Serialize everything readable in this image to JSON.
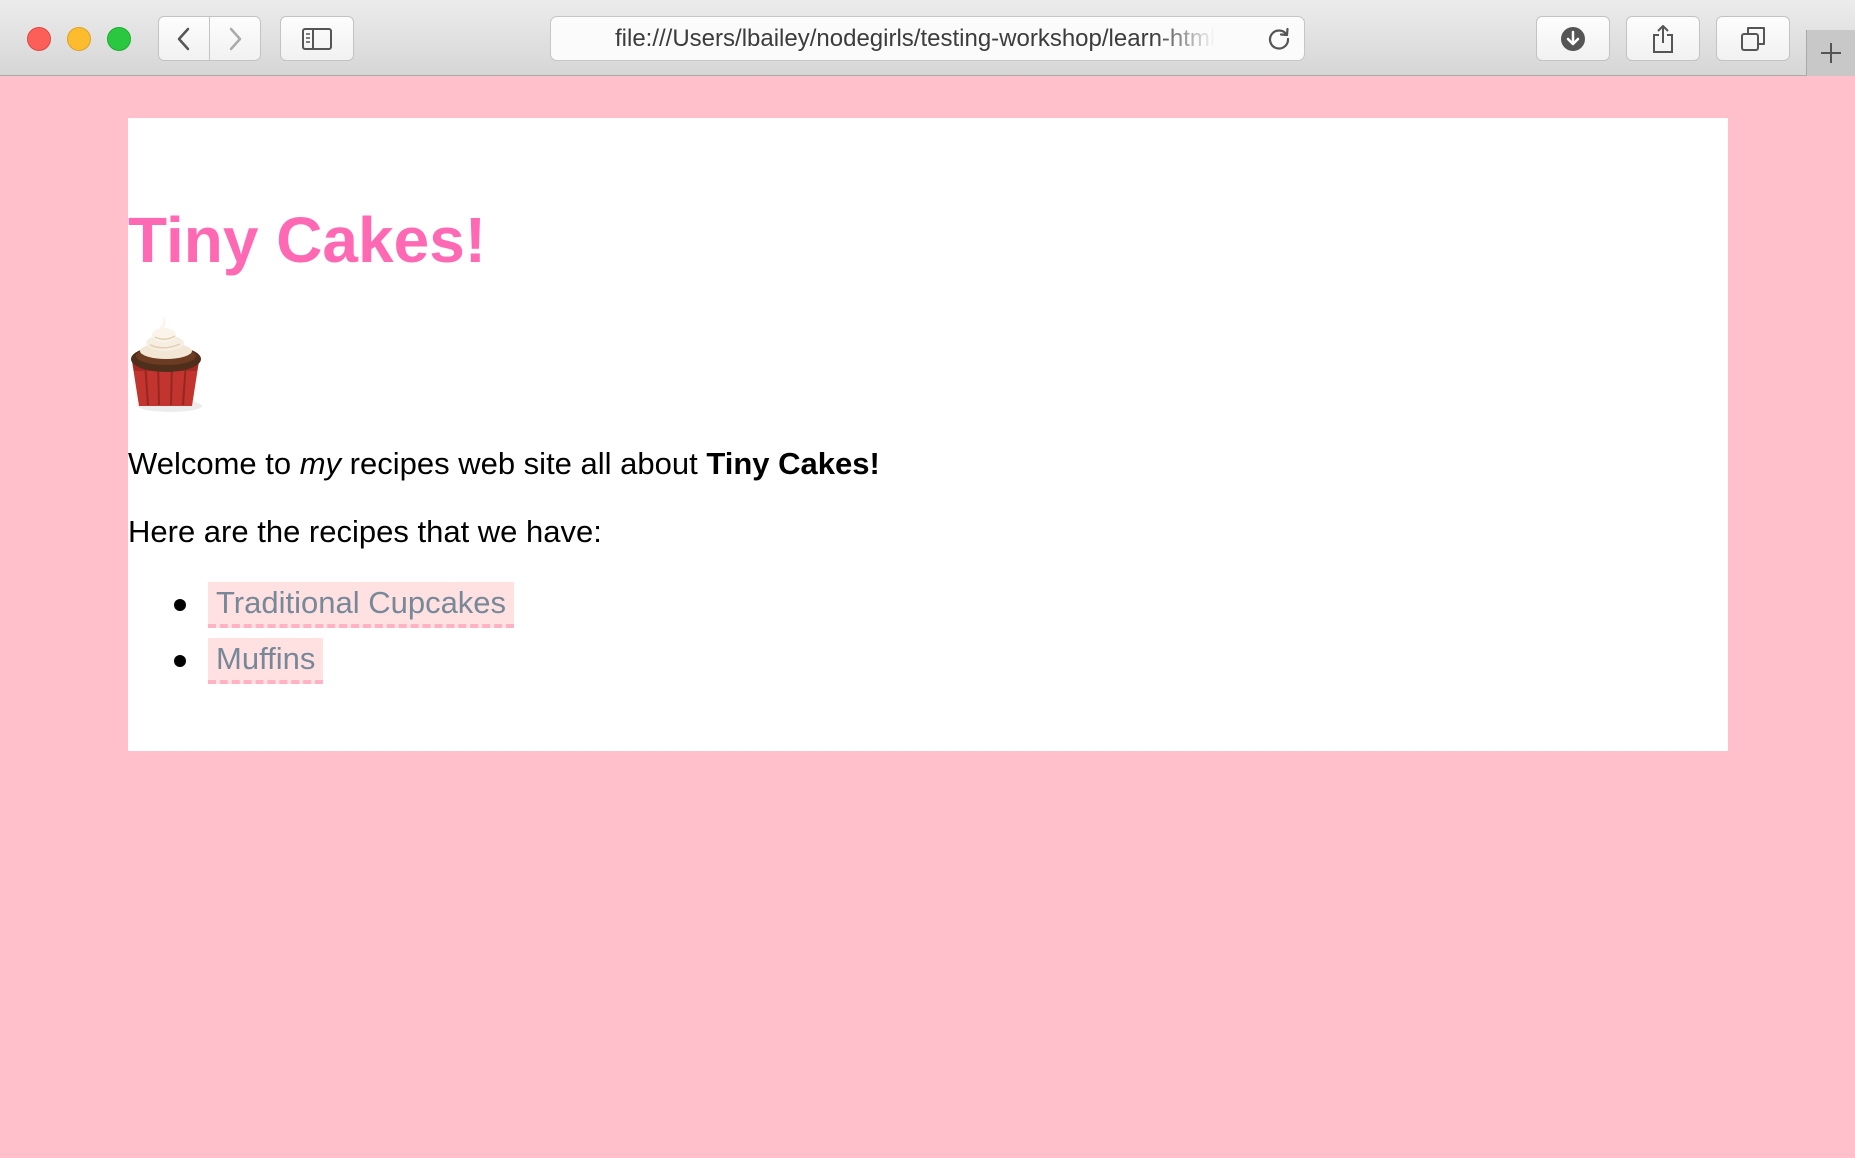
{
  "browser": {
    "url": "file:///Users/lbailey/nodegirls/testing-workshop/learn-html/index.html"
  },
  "page": {
    "title": "Tiny Cakes!",
    "welcome": {
      "before": "Welcome to ",
      "emphasis": "my",
      "middle": " recipes web site all about ",
      "strong": "Tiny Cakes!"
    },
    "intro": "Here are the recipes that we have:",
    "recipes": [
      {
        "label": "Traditional Cupcakes"
      },
      {
        "label": "Muffins"
      }
    ]
  },
  "icons": {
    "cupcake": "cupcake-image",
    "back": "chevron-left-icon",
    "forward": "chevron-right-icon",
    "sidebar": "sidebar-icon",
    "reload": "reload-icon",
    "download": "download-icon",
    "share": "share-icon",
    "tabs": "tabs-overview-icon",
    "new_tab": "plus-icon"
  },
  "colors": {
    "background": "#ffc0cb",
    "title": "#ff69b4",
    "link": "#778899",
    "link_background": "#ffe1e1",
    "link_border": "#ffb2c4"
  }
}
